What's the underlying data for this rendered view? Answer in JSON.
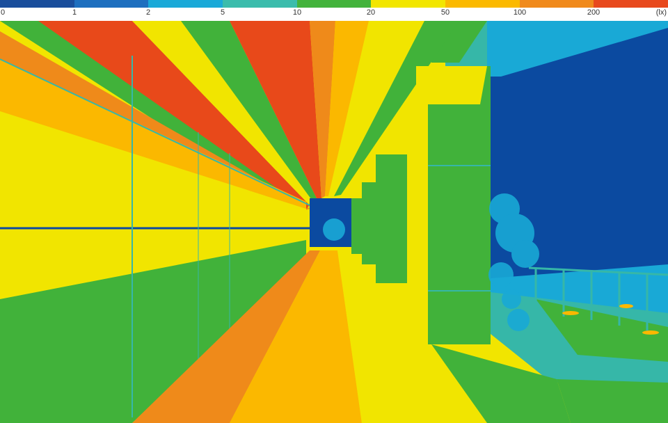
{
  "legend": {
    "ticks": [
      "0",
      "1",
      "2",
      "5",
      "10",
      "20",
      "50",
      "100",
      "200"
    ],
    "unit": "(lx)",
    "colors": [
      "#1a4e9c",
      "#1e6fbf",
      "#1aa9d8",
      "#3bbcac",
      "#43b33c",
      "#f2e600",
      "#fbb900",
      "#f08a1c",
      "#e8491d"
    ]
  },
  "scene_palette": {
    "dark_blue": "#0b4aa0",
    "cyan": "#19a9d6",
    "teal": "#36b7a8",
    "green": "#41b23a",
    "yellow": "#f1e500",
    "gold": "#fbb800",
    "orange": "#ef8a1a",
    "red": "#e8491a"
  }
}
